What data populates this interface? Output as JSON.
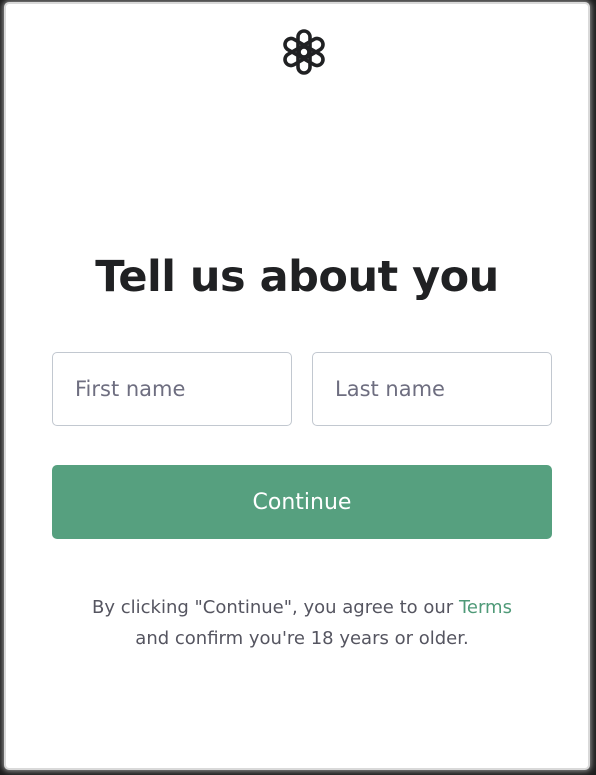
{
  "brand": {
    "logo_icon": "openai-knot-icon",
    "accent_color": "#56a07f",
    "link_color": "#4f9a78"
  },
  "heading": "Tell us about you",
  "form": {
    "first_name_placeholder": "First name",
    "last_name_placeholder": "Last name",
    "first_name_value": "",
    "last_name_value": "",
    "continue_label": "Continue"
  },
  "legal": {
    "line1_prefix": "By clicking \"Continue\", you agree to our ",
    "terms_link": "Terms",
    "line2": "and confirm you're 18 years or older."
  }
}
